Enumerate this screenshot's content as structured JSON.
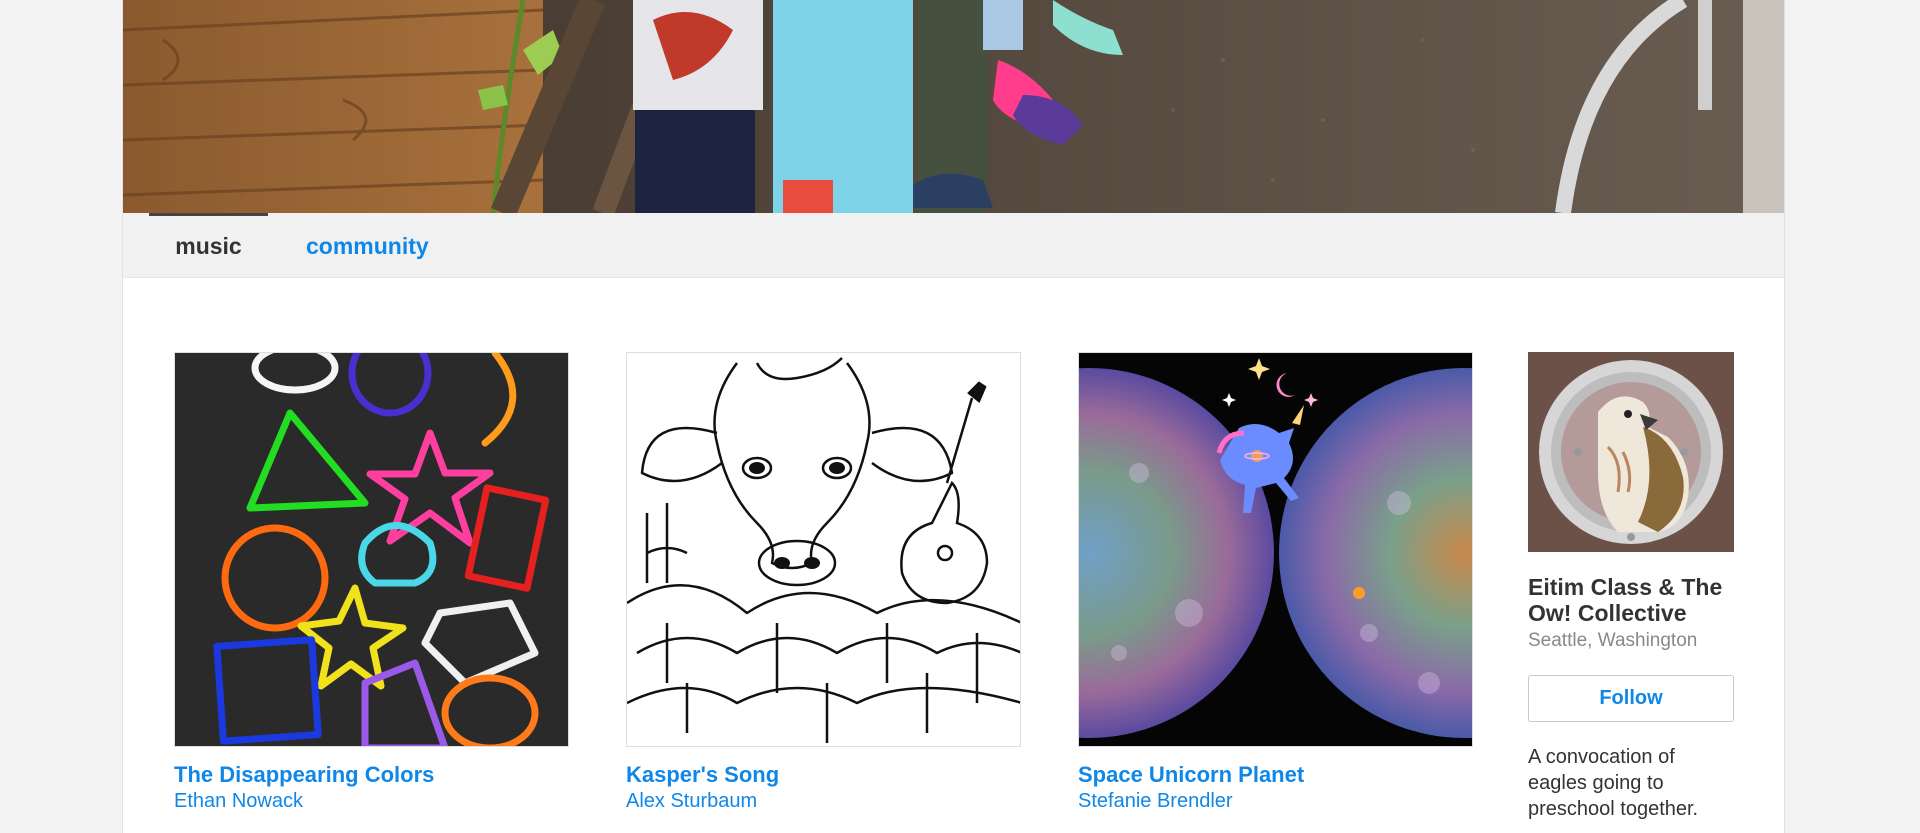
{
  "tabs": {
    "music": "music",
    "community": "community"
  },
  "albums": [
    {
      "title": "The Disappearing Colors",
      "artist": "Ethan Nowack"
    },
    {
      "title": "Kasper's Song",
      "artist": "Alex Sturbaum"
    },
    {
      "title": "Space Unicorn Planet",
      "artist": "Stefanie Brendler"
    }
  ],
  "profile": {
    "name": "Eitim Class & The Ow! Collective",
    "location": "Seattle, Washington",
    "follow_label": "Follow",
    "bio": "A convocation of eagles going to preschool together."
  },
  "colors": {
    "link": "#0f87e8",
    "tab_bar": "#f1f1f1",
    "page_bg": "#f3f3f3"
  }
}
